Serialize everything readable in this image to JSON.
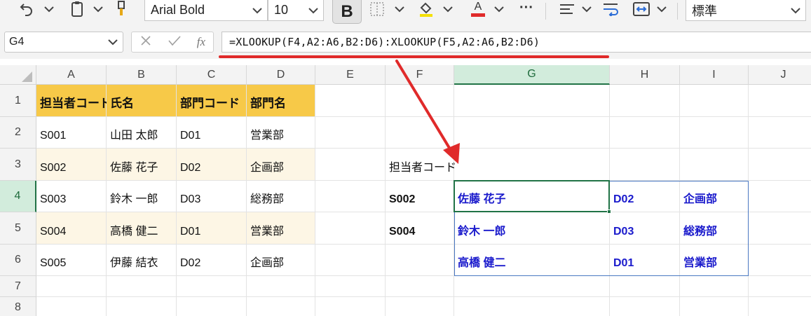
{
  "ribbon": {
    "font_name": "Arial Bold",
    "font_size": "10",
    "bold_label": "B",
    "font_color_letter": "A",
    "more_label": "···",
    "number_format": "標準"
  },
  "formula_bar": {
    "name_box": "G4",
    "fx_label": "fx",
    "formula": "=XLOOKUP(F4,A2:A6,B2:D6):XLOOKUP(F5,A2:A6,B2:D6)"
  },
  "columns": [
    "A",
    "B",
    "C",
    "D",
    "E",
    "F",
    "G",
    "H",
    "I",
    "J"
  ],
  "rows": [
    "1",
    "2",
    "3",
    "4",
    "5",
    "6",
    "7",
    "8"
  ],
  "selected_column": "G",
  "selected_row": "4",
  "cells": {
    "A1": "担当者コード",
    "B1": "氏名",
    "C1": "部門コード",
    "D1": "部門名",
    "A2": "S001",
    "B2": "山田 太郎",
    "C2": "D01",
    "D2": "営業部",
    "A3": "S002",
    "B3": "佐藤 花子",
    "C3": "D02",
    "D3": "企画部",
    "A4": "S003",
    "B4": "鈴木 一郎",
    "C4": "D03",
    "D4": "総務部",
    "A5": "S004",
    "B5": "高橋 健二",
    "C5": "D01",
    "D5": "営業部",
    "A6": "S005",
    "B6": "伊藤 結衣",
    "C6": "D02",
    "D6": "企画部",
    "F3": "担当者コード",
    "F4": "S002",
    "F5": "S004",
    "G4": "佐藤 花子",
    "H4": "D02",
    "I4": "企画部",
    "G5": "鈴木 一郎",
    "H5": "D03",
    "I5": "総務部",
    "G6": "高橋 健二",
    "H6": "D01",
    "I6": "営業部"
  },
  "colors": {
    "header_fill": "#f7c948",
    "band_fill": "#fdf6e5",
    "result_text": "#1a1acc",
    "selection_green": "#217346",
    "annotation_red": "#e02a2a",
    "spill_border": "#4a78c2"
  }
}
